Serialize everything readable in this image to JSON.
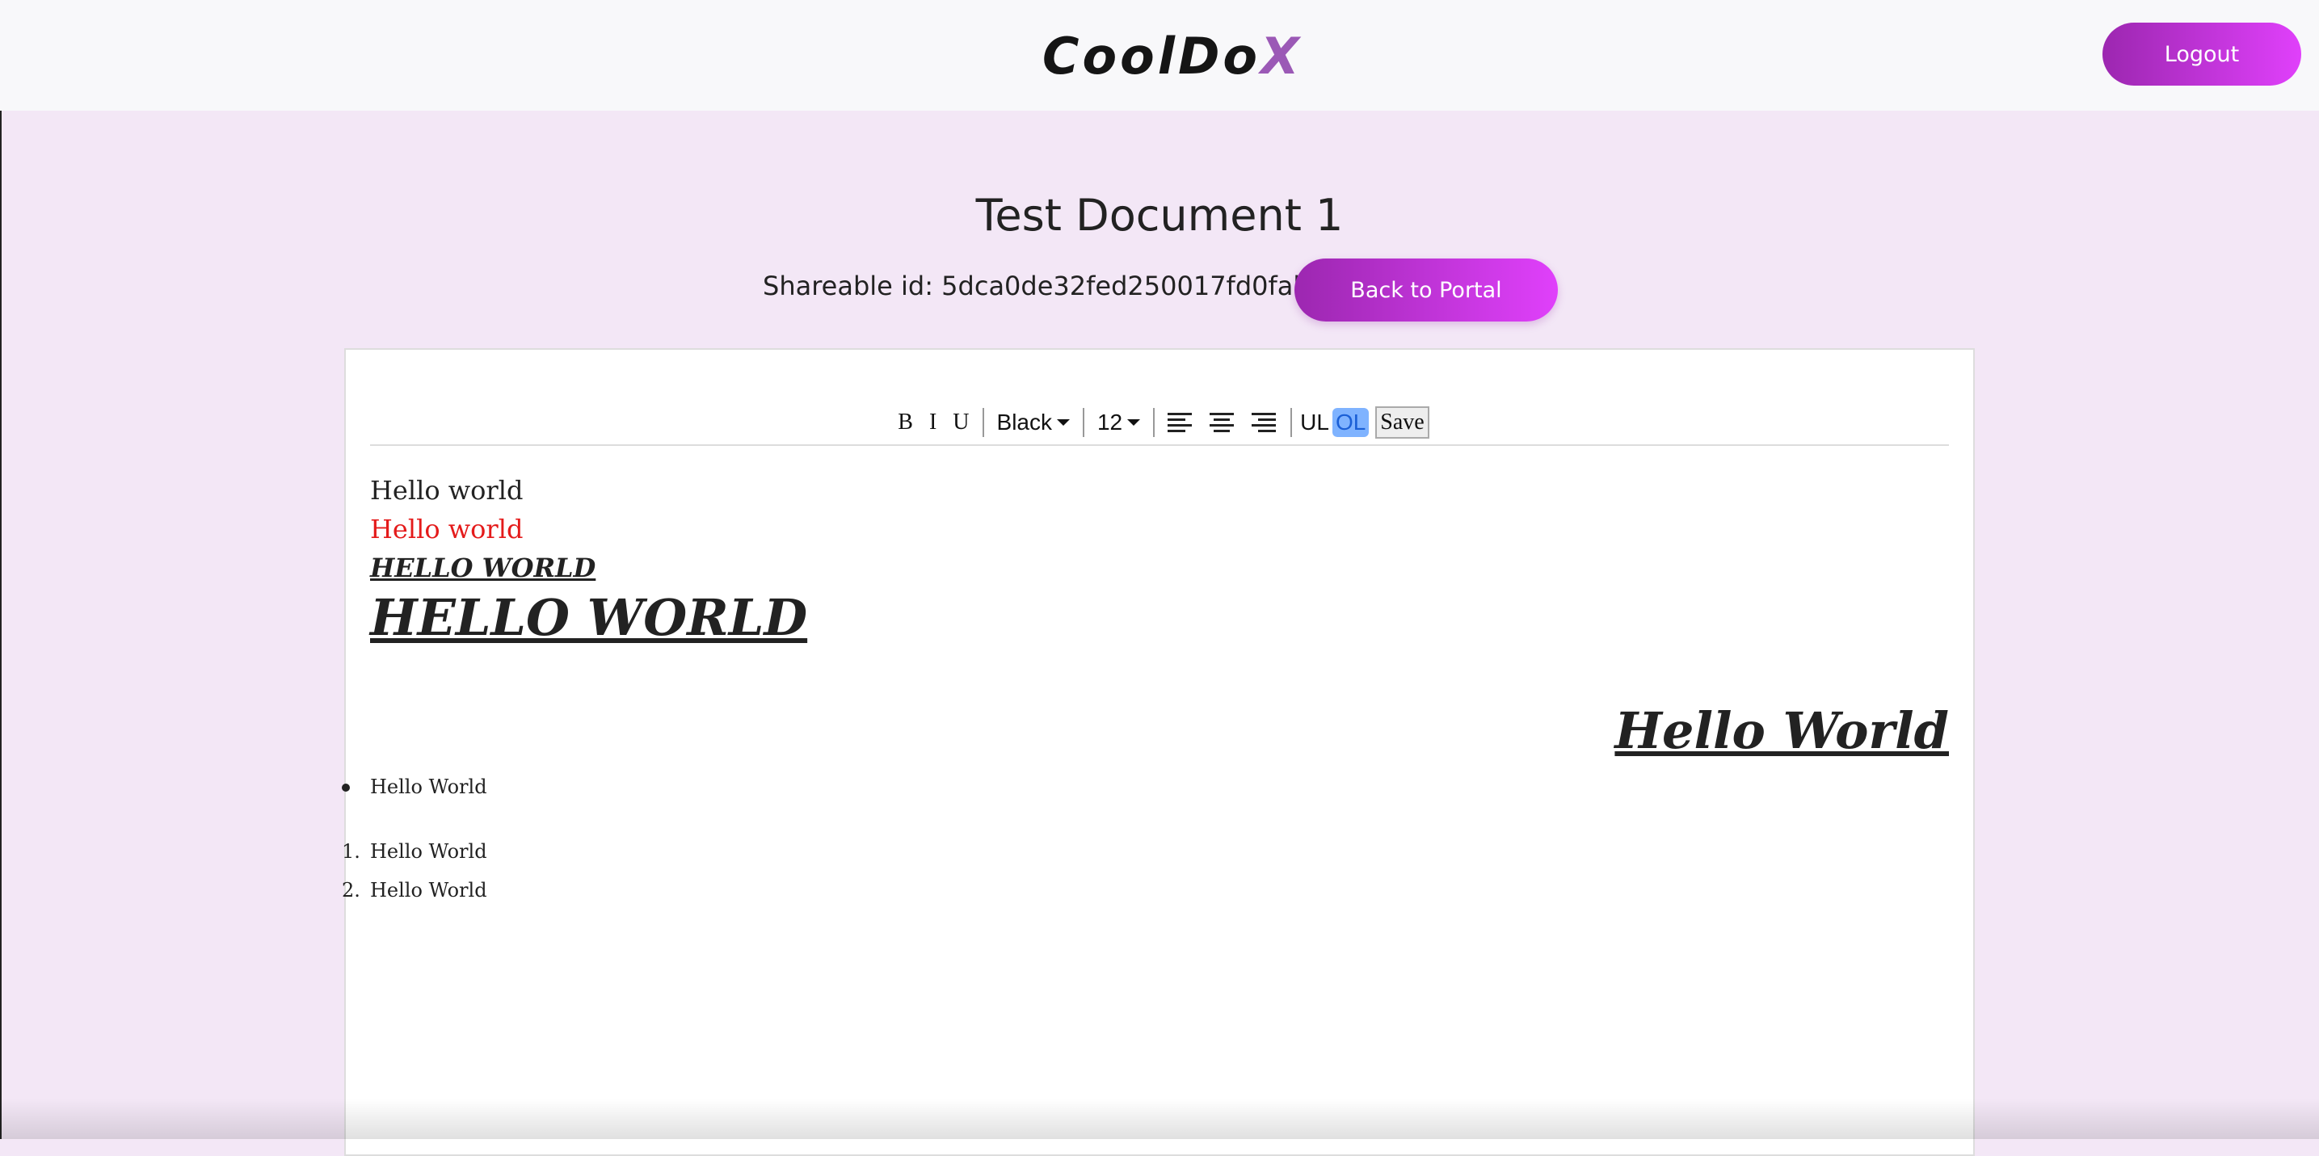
{
  "header": {
    "logo_main": "CoolDo",
    "logo_x": "X",
    "logout_label": "Logout"
  },
  "document": {
    "title": "Test Document 1",
    "shareable_label": "Shareable id: 5dca0de32fed250017fd0fab",
    "back_label": "Back to Portal"
  },
  "toolbar": {
    "bold": "B",
    "italic": "I",
    "underline": "U",
    "color": "Black",
    "size": "12",
    "ul": "UL",
    "ol": "OL",
    "save": "Save",
    "icons": [
      "align-left-icon",
      "align-center-icon",
      "align-right-icon"
    ]
  },
  "content": {
    "line1": "Hello world",
    "line2": "Hello world",
    "line2_color": "#e41b1b",
    "line3": "HELLO WORLD",
    "line4": "HELLO WORLD",
    "line5": "Hello World",
    "bullet": "Hello World",
    "ordered": [
      {
        "num": "1.",
        "text": "Hello World"
      },
      {
        "num": "2.",
        "text": "Hello World"
      }
    ]
  },
  "colors": {
    "accent_start": "#9c27b0",
    "accent_end": "#e040fb",
    "page_bg": "#f3e7f6"
  }
}
